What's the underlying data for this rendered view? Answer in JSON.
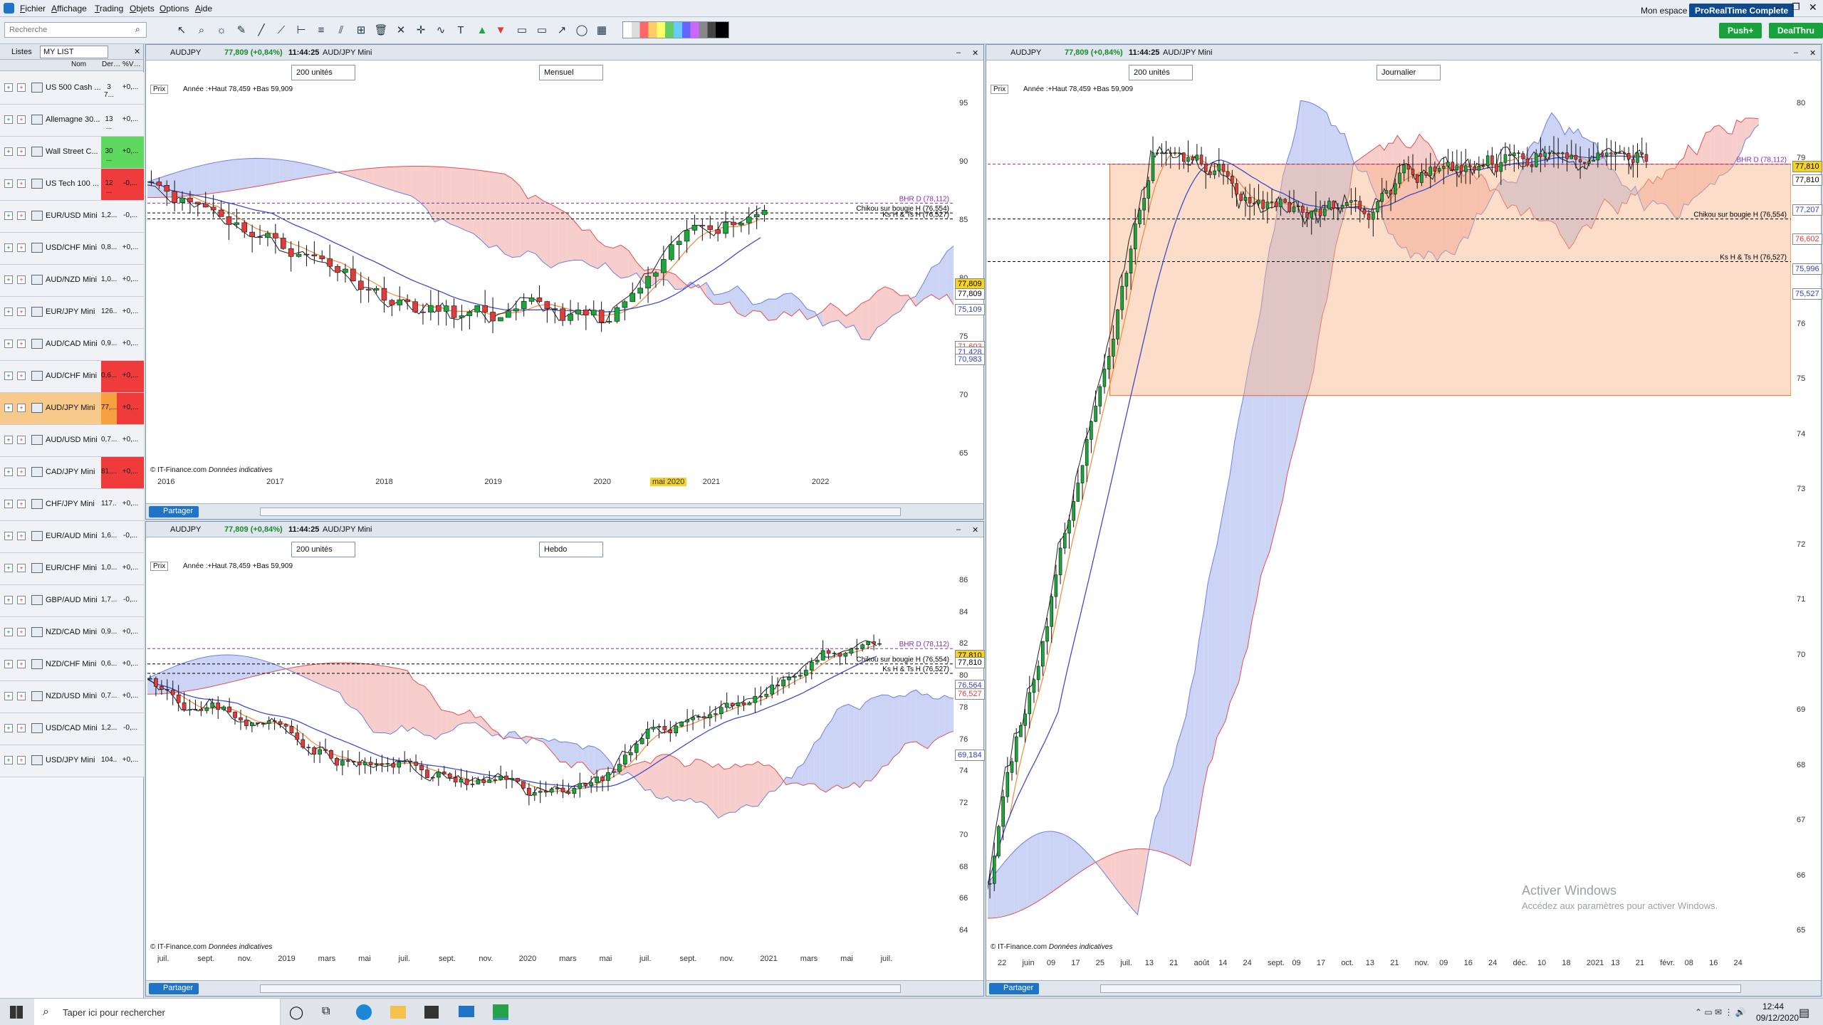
{
  "menu": [
    "Fichier",
    "Affichage",
    "Trading",
    "Objets",
    "Options",
    "Aide"
  ],
  "search": {
    "placeholder": "Recherche"
  },
  "topright": {
    "space": "Mon espace",
    "badge": "ProRealTime Complete",
    "push": "Push+",
    "dealthru": "DealThru"
  },
  "leftpanel": {
    "tab_lists": "Listes",
    "tab_mylist": "MY LIST",
    "col_name": "Nom",
    "col_last": "Der…",
    "col_pct": "%V…",
    "rows": [
      {
        "name": "US 500 Cash ...",
        "last": "3 7...",
        "pct": "+0,...",
        "bg1": "#f0f2f5",
        "bg2": "#f0f2f5"
      },
      {
        "name": "Allemagne 30...",
        "last": "13 ...",
        "pct": "+0,...",
        "bg1": "#f0f2f5",
        "bg2": "#f0f2f5"
      },
      {
        "name": "Wall Street C...",
        "last": "30 ...",
        "pct": "+0,...",
        "bg1": "#5fd85f",
        "bg2": "#5fd85f"
      },
      {
        "name": "US Tech 100 ...",
        "last": "12 ...",
        "pct": "-0,...",
        "bg1": "#ef3b3b",
        "bg2": "#ef3b3b"
      },
      {
        "name": "EUR/USD Mini",
        "last": "1,2...",
        "pct": "-0,...",
        "bg1": "#f0f2f5",
        "bg2": "#f0f2f5"
      },
      {
        "name": "USD/CHF Mini",
        "last": "0,8...",
        "pct": "+0,...",
        "bg1": "#f0f2f5",
        "bg2": "#f0f2f5"
      },
      {
        "name": "AUD/NZD Mini",
        "last": "1,0...",
        "pct": "+0,...",
        "bg1": "#f0f2f5",
        "bg2": "#f0f2f5"
      },
      {
        "name": "EUR/JPY Mini",
        "last": "126...",
        "pct": "+0,...",
        "bg1": "#f0f2f5",
        "bg2": "#f0f2f5"
      },
      {
        "name": "AUD/CAD Mini",
        "last": "0,9...",
        "pct": "+0,...",
        "bg1": "#f0f2f5",
        "bg2": "#f0f2f5"
      },
      {
        "name": "AUD/CHF Mini",
        "last": "0,6...",
        "pct": "+0,...",
        "bg1": "#ef3b3b",
        "bg2": "#ef3b3b"
      },
      {
        "name": "AUD/JPY Mini",
        "last": "77,...",
        "pct": "+0,...",
        "bg1": "#f6a040",
        "bg2": "#ef3b3b",
        "selected": true
      },
      {
        "name": "AUD/USD Mini",
        "last": "0,7...",
        "pct": "+0,...",
        "bg1": "#f0f2f5",
        "bg2": "#f0f2f5"
      },
      {
        "name": "CAD/JPY Mini",
        "last": "81,...",
        "pct": "+0,...",
        "bg1": "#ef3b3b",
        "bg2": "#ef3b3b"
      },
      {
        "name": "CHF/JPY Mini",
        "last": "117...",
        "pct": "+0,...",
        "bg1": "#f0f2f5",
        "bg2": "#f0f2f5"
      },
      {
        "name": "EUR/AUD Mini",
        "last": "1,6...",
        "pct": "-0,...",
        "bg1": "#f0f2f5",
        "bg2": "#f0f2f5"
      },
      {
        "name": "EUR/CHF Mini",
        "last": "1,0...",
        "pct": "+0,...",
        "bg1": "#f0f2f5",
        "bg2": "#f0f2f5"
      },
      {
        "name": "GBP/AUD Mini",
        "last": "1,7...",
        "pct": "-0,...",
        "bg1": "#f0f2f5",
        "bg2": "#f0f2f5"
      },
      {
        "name": "NZD/CAD Mini",
        "last": "0,9...",
        "pct": "+0,...",
        "bg1": "#f0f2f5",
        "bg2": "#f0f2f5"
      },
      {
        "name": "NZD/CHF Mini",
        "last": "0,6...",
        "pct": "+0,...",
        "bg1": "#f0f2f5",
        "bg2": "#f0f2f5"
      },
      {
        "name": "NZD/USD Mini",
        "last": "0,7...",
        "pct": "+0,...",
        "bg1": "#f0f2f5",
        "bg2": "#f0f2f5"
      },
      {
        "name": "USD/CAD Mini",
        "last": "1,2...",
        "pct": "-0,...",
        "bg1": "#f0f2f5",
        "bg2": "#f0f2f5"
      },
      {
        "name": "USD/JPY Mini",
        "last": "104...",
        "pct": "+0,...",
        "bg1": "#f0f2f5",
        "bg2": "#f0f2f5"
      }
    ]
  },
  "common": {
    "symbol": "AUDJPY",
    "quote": "77,809 (+0,84%)",
    "time": "11:44:25",
    "instrument": "AUD/JPY Mini",
    "units": "200 unités",
    "prix": "Prix",
    "annee": "Année :+Haut 78,459 +Bas 59,909",
    "copyright": "© IT-Finance.com",
    "copyright_note": "Données indicatives",
    "share": "Partager"
  },
  "panels": {
    "monthly": {
      "period": "Mensuel",
      "yaxis": [
        "95",
        "90",
        "85",
        "80",
        "75",
        "70",
        "65"
      ],
      "xaxis": [
        "2016",
        "2017",
        "2018",
        "2019",
        "2020",
        "2021",
        "2022"
      ],
      "xhighlight": "mai 2020",
      "bhr": "BHR D (78,112)",
      "chikou": "Chikou sur bougie H (76,554)",
      "ks": "Ks H & Ts H (76,527)",
      "pricetags": [
        "77,809",
        "77,809",
        "75,109",
        "71,603",
        "71,428",
        "70,983"
      ]
    },
    "weekly": {
      "period": "Hebdo",
      "yaxis": [
        "86",
        "84",
        "82",
        "80",
        "78",
        "76",
        "74",
        "72",
        "70",
        "68",
        "66",
        "64"
      ],
      "xaxis": [
        "juil.",
        "sept.",
        "nov.",
        "2019",
        "mars",
        "mai",
        "juil.",
        "sept.",
        "nov.",
        "2020",
        "mars",
        "mai",
        "juil.",
        "sept.",
        "nov.",
        "2021",
        "mars",
        "mai",
        "juil."
      ],
      "bhr": "BHR D (78,112)",
      "chikou": "Chikou sur bougie H (76,554)",
      "ks": "Ks H & Ts H (76,527)",
      "pricetags": [
        "77,810",
        "77,810",
        "76,564",
        "76,527",
        "69,184"
      ]
    },
    "daily": {
      "period": "Journalier",
      "yaxis": [
        "80",
        "79",
        "78",
        "77",
        "76",
        "75",
        "74",
        "73",
        "72",
        "71",
        "70",
        "69",
        "68",
        "67",
        "66",
        "65"
      ],
      "xaxis": [
        "22",
        "juin",
        "09",
        "17",
        "25",
        "juil.",
        "13",
        "21",
        "août",
        "14",
        "24",
        "sept.",
        "09",
        "17",
        "oct.",
        "13",
        "21",
        "nov.",
        "09",
        "16",
        "24",
        "déc.",
        "10",
        "18",
        "2021",
        "13",
        "21",
        "févr.",
        "08",
        "16",
        "24"
      ],
      "bhr": "BHR D (78,112)",
      "chikou": "Chikou sur bougie H (76,554)",
      "ks": "Ks H & Ts H (76,527)",
      "pricetags": [
        "77,810",
        "77,810",
        "77,207",
        "76,602",
        "75,996",
        "75,527"
      ]
    }
  },
  "watermark": {
    "title": "Activer Windows",
    "sub": "Accédez aux paramètres pour activer Windows."
  },
  "taskbar": {
    "search": "Taper ici pour rechercher",
    "time": "12:44",
    "date": "09/12/2020"
  },
  "colors": {
    "up": "#1aa83a",
    "down": "#e23b3b",
    "kumo_red": "#f6c6c2",
    "kumo_blue": "#c3cdf3",
    "tenkan": "#ef8a3a",
    "kijun": "#3340c8",
    "chikou": "#222222",
    "bhr": "#8e2bb0"
  }
}
